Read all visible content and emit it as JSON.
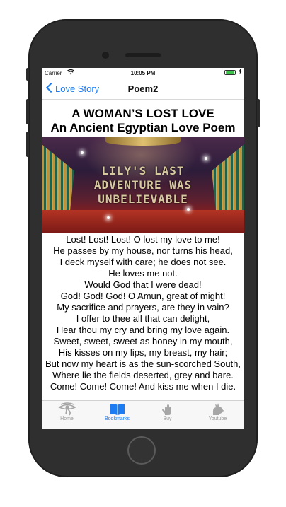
{
  "status_bar": {
    "carrier": "Carrier",
    "time": "10:05 PM"
  },
  "nav": {
    "back_label": "Love Story",
    "title": "Poem2"
  },
  "poem": {
    "title_line1": "A WOMAN’S LOST LOVE",
    "title_line2": "An Ancient Egyptian Love Poem",
    "banner_text": "LILY'S LAST\nADVENTURE WAS\nUNBELIEVABLE",
    "lines": [
      "Lost! Lost! Lost! O lost my love to me!",
      "He passes by my house, nor turns his head,",
      "I deck myself with care; he does not see.",
      "He loves me not.",
      "Would God that I were dead!",
      "God! God! God! O Amun, great of might!",
      "My sacrifice and prayers, are they in vain?",
      "I offer to thee all that can delight,",
      "Hear thou my cry and bring my love again.",
      "Sweet, sweet, sweet as honey in my mouth,",
      "His kisses on my lips, my breast, my hair;",
      "But now my heart is as the sun-scorched South,",
      "Where lie the fields deserted, grey and bare.",
      "Come! Come! Come! And kiss me when I die."
    ]
  },
  "tabs": [
    {
      "label": "Home",
      "icon": "eye-of-horus-icon",
      "active": false
    },
    {
      "label": "Bookmarks",
      "icon": "book-icon",
      "active": true
    },
    {
      "label": "Buy",
      "icon": "hand-icon",
      "active": false
    },
    {
      "label": "Youtube",
      "icon": "anubis-icon",
      "active": false
    }
  ],
  "colors": {
    "accent": "#1e7cf2",
    "battery": "#3cc24a",
    "tab_inactive": "#9a9a9a"
  }
}
